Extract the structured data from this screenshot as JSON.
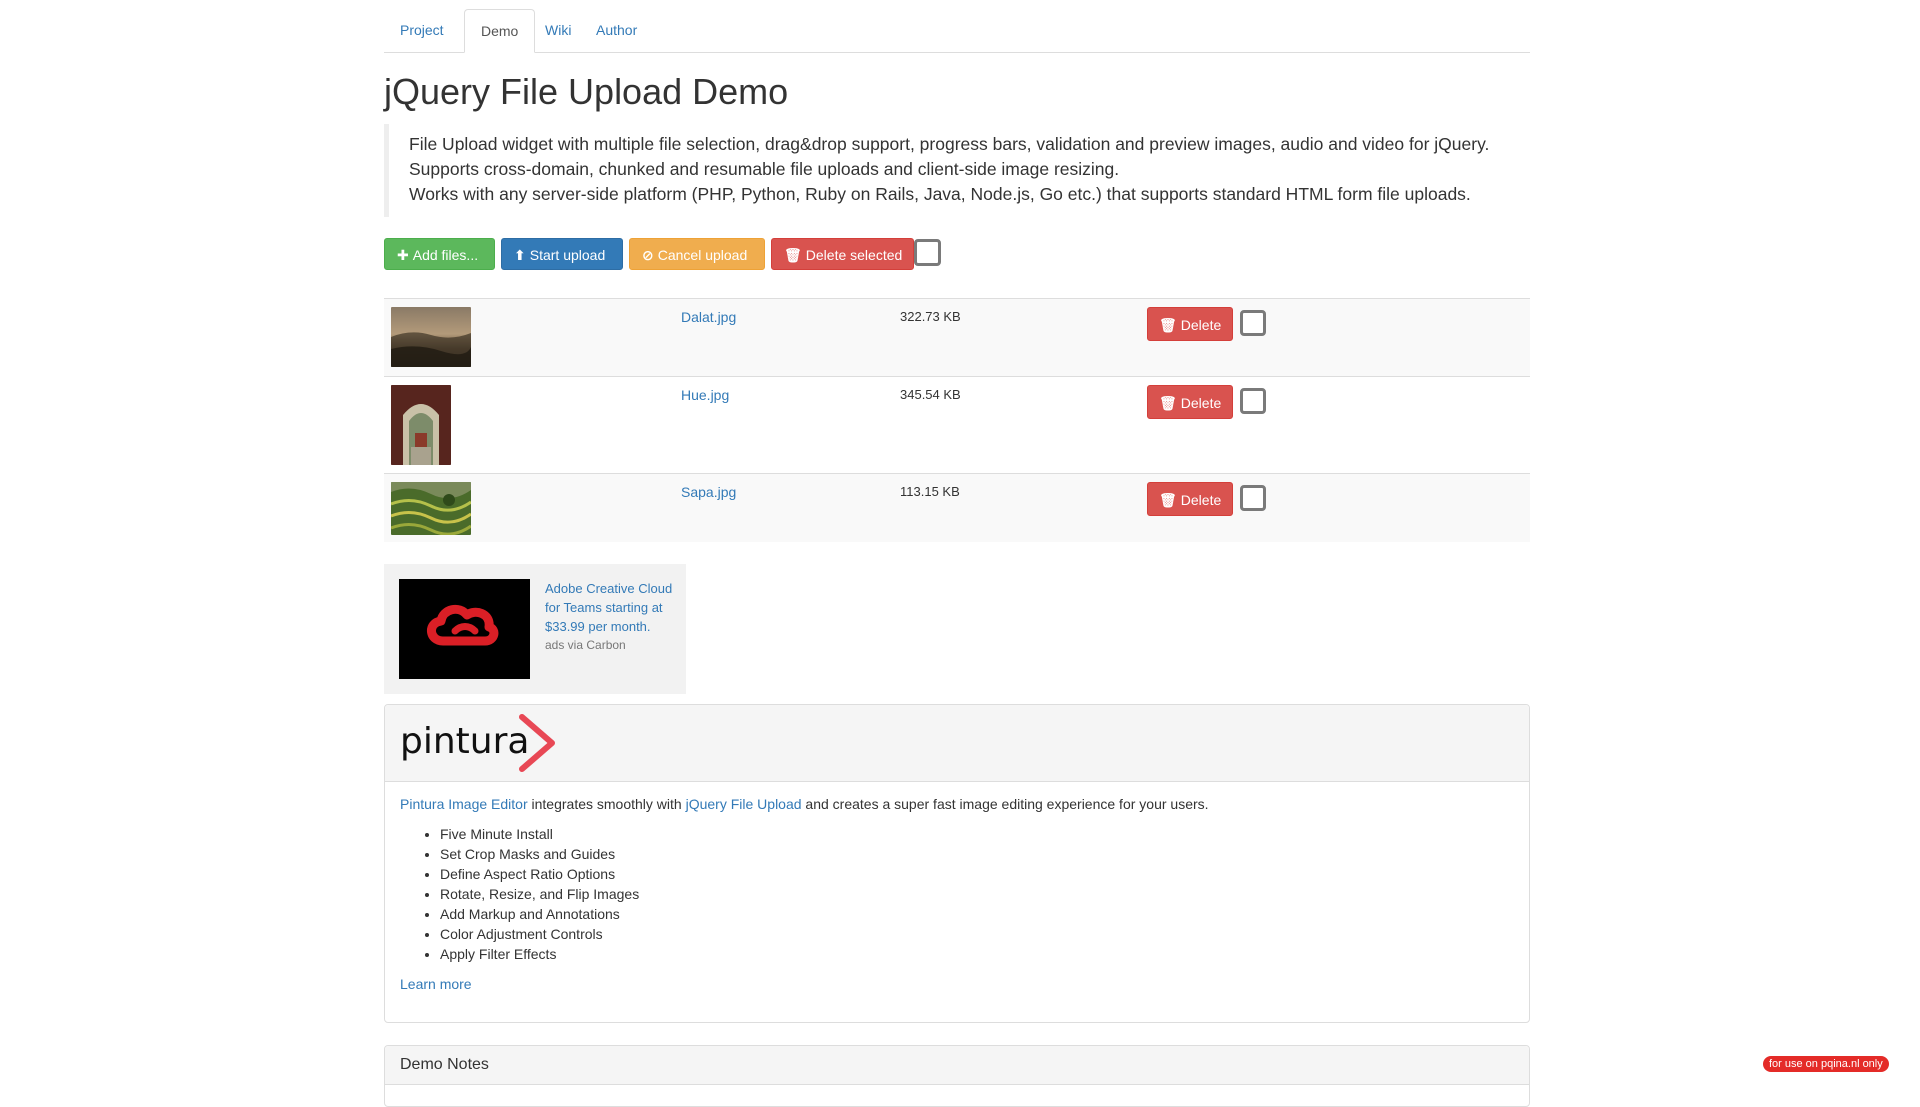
{
  "tabs": [
    {
      "label": "Project"
    },
    {
      "label": "Demo"
    },
    {
      "label": "Wiki"
    },
    {
      "label": "Author"
    }
  ],
  "active_tab": "Demo",
  "page_title": "jQuery File Upload Demo",
  "lead_lines": [
    "File Upload widget with multiple file selection, drag&drop support, progress bars, validation and preview images, audio and video for jQuery.",
    "Supports cross-domain, chunked and resumable file uploads and client-side image resizing.",
    "Works with any server-side platform (PHP, Python, Ruby on Rails, Java, Node.js, Go etc.) that supports standard HTML form file uploads."
  ],
  "toolbar": {
    "add_label": "Add files...",
    "start_label": "Start upload",
    "cancel_label": "Cancel upload",
    "delete_label": "Delete selected"
  },
  "files": [
    {
      "name": "Dalat.jpg",
      "size": "322.73 KB",
      "delete_label": "Delete"
    },
    {
      "name": "Hue.jpg",
      "size": "345.54 KB",
      "delete_label": "Delete"
    },
    {
      "name": "Sapa.jpg",
      "size": "113.15 KB",
      "delete_label": "Delete"
    }
  ],
  "ad": {
    "text": "Adobe Creative Cloud for Teams starting at $33.99 per month.",
    "via": "ads via Carbon"
  },
  "pintura": {
    "logo_text": "pintura",
    "intro_link1": "Pintura Image Editor",
    "intro_mid": " integrates smoothly with ",
    "intro_link2": "jQuery File Upload",
    "intro_end": " and creates a super fast image editing experience for your users.",
    "features": [
      "Five Minute Install",
      "Set Crop Masks and Guides",
      "Define Aspect Ratio Options",
      "Rotate, Resize, and Flip Images",
      "Add Markup and Annotations",
      "Color Adjustment Controls",
      "Apply Filter Effects"
    ],
    "learn_more": "Learn more"
  },
  "demo_notes_title": "Demo Notes",
  "corner_badge": "for use on pqina.nl only",
  "colors": {
    "success": "#5cb85c",
    "primary": "#337ab7",
    "warning": "#f0ad4e",
    "danger": "#d9534f",
    "link": "#337ab7",
    "pintura_accent": "#e84855"
  }
}
